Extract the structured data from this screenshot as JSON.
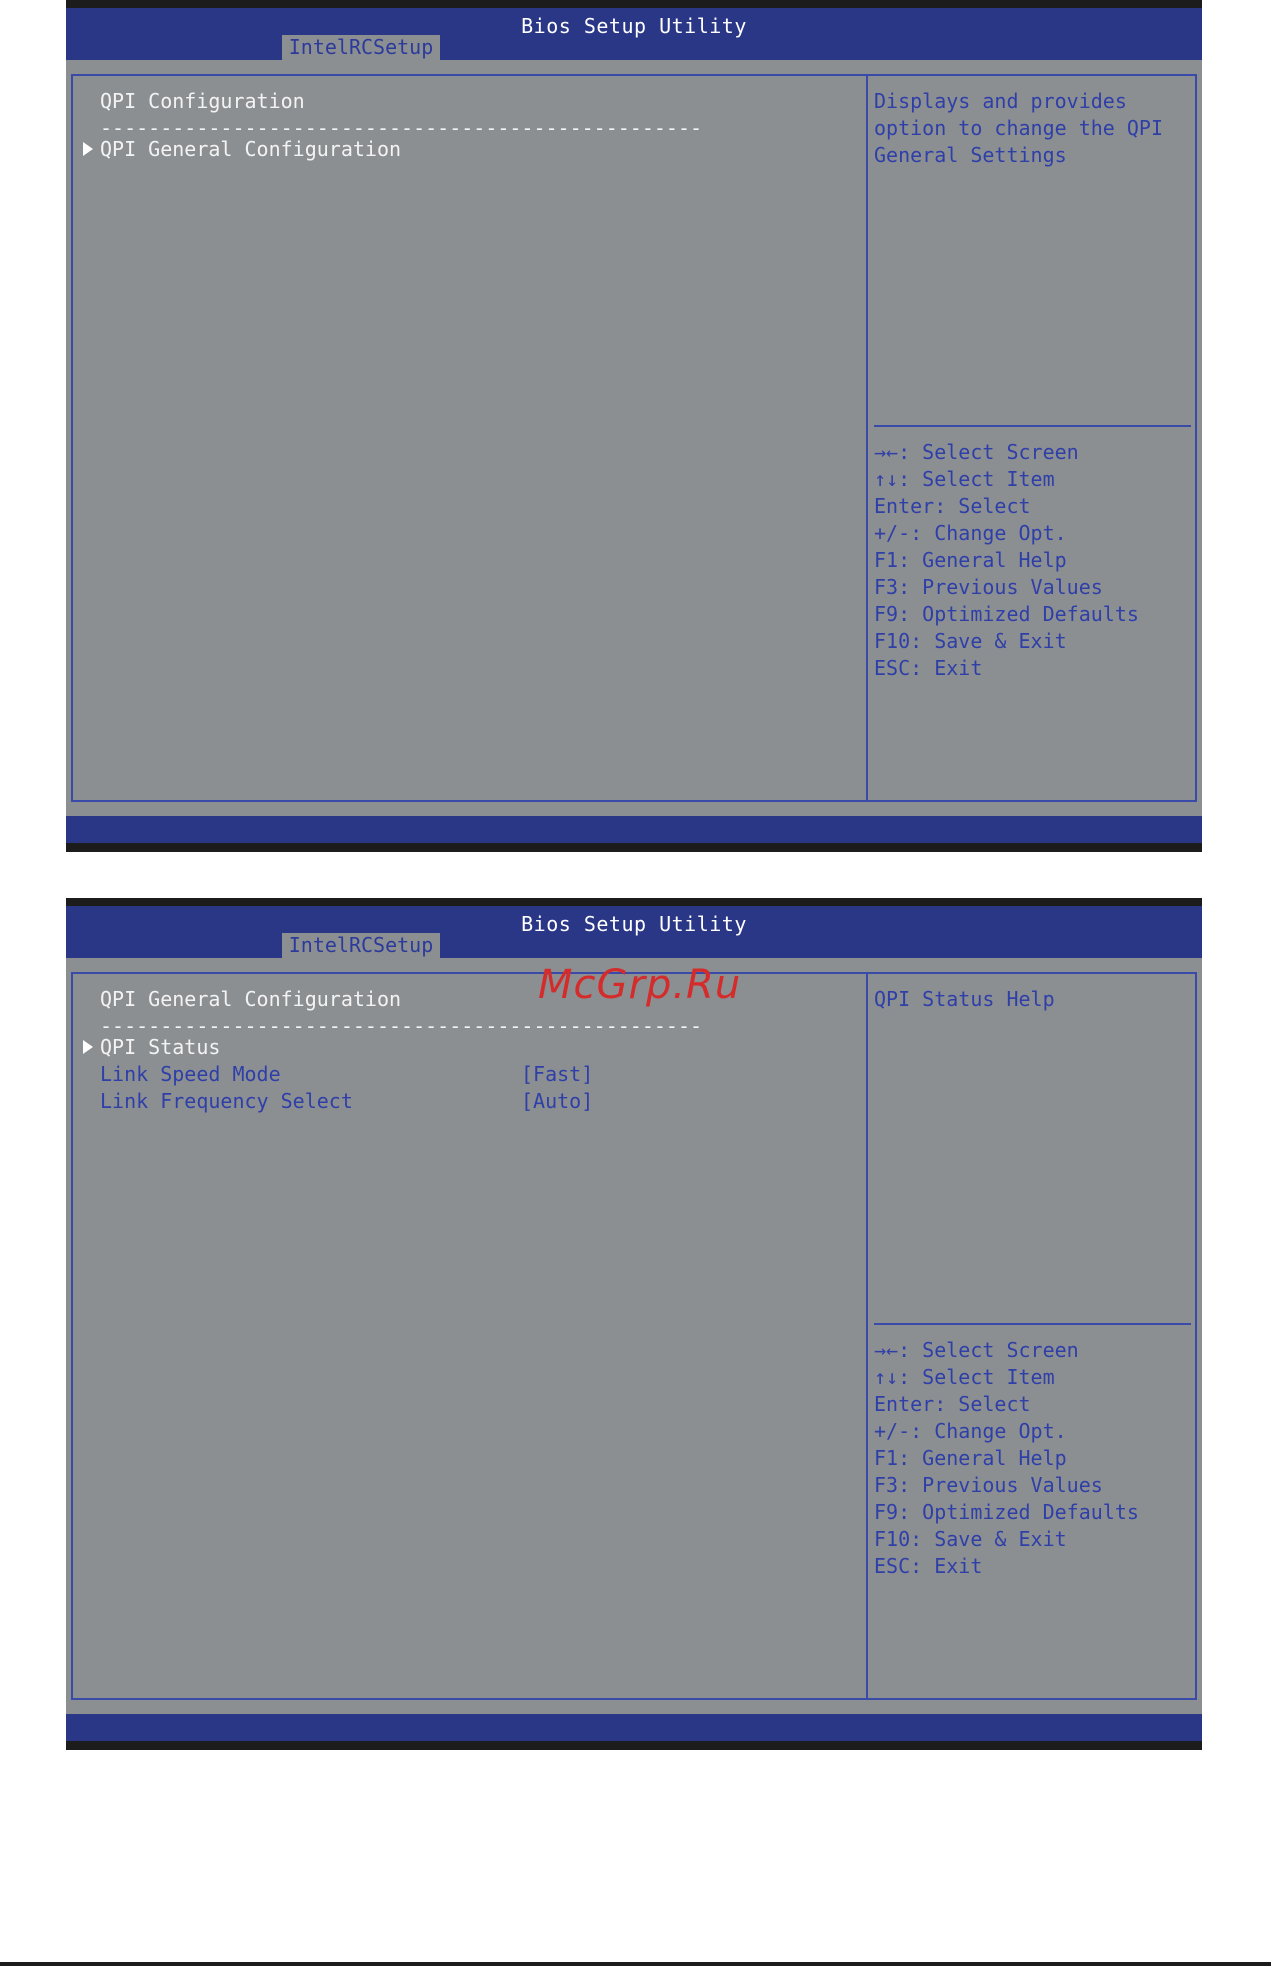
{
  "screens": [
    {
      "app_title": "Bios Setup Utility",
      "tab": "IntelRCSetup",
      "main": {
        "heading": "QPI Configuration",
        "divider": "--------------------------------------------------",
        "items": [
          {
            "label": "QPI General Configuration",
            "submenu": true,
            "value": ""
          }
        ]
      },
      "help_text": [
        "Displays and provides",
        "option to change the QPI",
        "General Settings"
      ],
      "keys": [
        "→←: Select Screen",
        "↑↓: Select Item",
        "Enter: Select",
        "+/-: Change Opt.",
        "F1: General Help",
        "F3: Previous Values",
        "F9: Optimized Defaults",
        "F10: Save & Exit",
        "ESC: Exit"
      ]
    },
    {
      "app_title": "Bios Setup Utility",
      "tab": "IntelRCSetup",
      "main": {
        "heading": "QPI General Configuration",
        "divider": "--------------------------------------------------",
        "items": [
          {
            "label": "QPI Status",
            "submenu": true,
            "value": ""
          },
          {
            "label": "Link Speed Mode",
            "submenu": false,
            "value": "[Fast]"
          },
          {
            "label": "Link Frequency Select",
            "submenu": false,
            "value": "[Auto]"
          }
        ]
      },
      "help_text": [
        "QPI Status Help"
      ],
      "keys": [
        "→←: Select Screen",
        "↑↓: Select Item",
        "Enter: Select",
        "+/-: Change Opt.",
        "F1: General Help",
        "F3: Previous Values",
        "F9: Optimized Defaults",
        "F10: Save & Exit",
        "ESC: Exit"
      ]
    }
  ],
  "watermark": "McGrp.Ru",
  "colors": {
    "header": "#2a3686",
    "panel_bg": "#8c8f92",
    "accent_blue": "#2f3fa8",
    "watermark": "#d42b2b"
  }
}
